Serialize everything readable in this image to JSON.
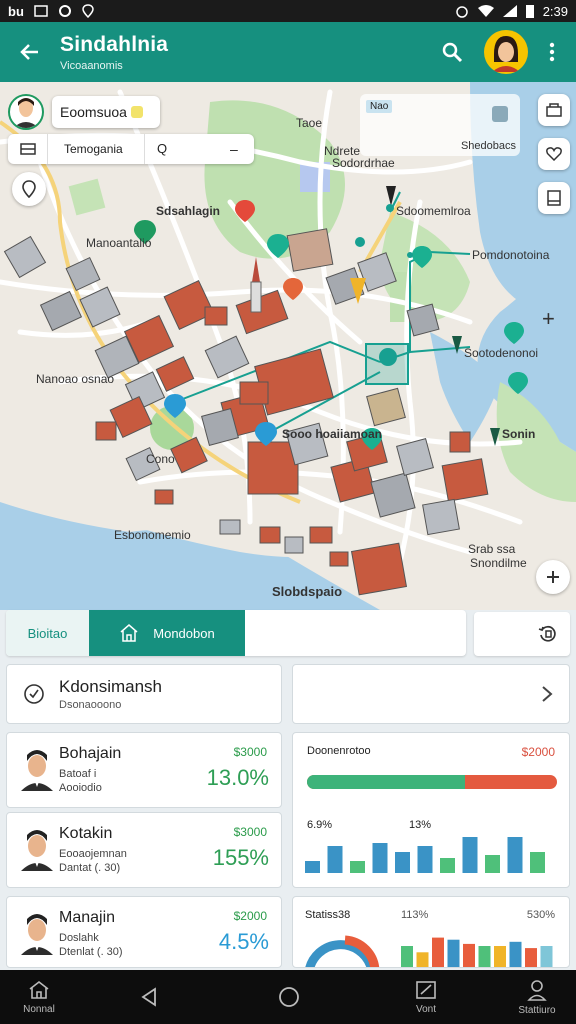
{
  "status_bar": {
    "left_text": "bu",
    "time": "2:39"
  },
  "app_bar": {
    "title": "Sindahlnia",
    "subtitle": "Vicoaanomis"
  },
  "map": {
    "search_chip": "Eoomsuoa",
    "filter_text": "Temogania",
    "filter_icon_label": "Q",
    "top_card_badge": "Nao",
    "top_card_right": "Shedobacs",
    "labels": {
      "tree": "Taoe",
      "north": "Ndrete",
      "north2": "Sodordrhae",
      "marker1": "Sdsahlagin",
      "marker2": "Sdoomemlroa",
      "west1": "Manoantalio",
      "east1": "Pomdonotoina",
      "center_right": "Sootodenonoi",
      "left_mid": "Nanoao osnao",
      "center": "Sooo hoaiiamoan",
      "center2": "Sonin",
      "south_left": "Esbonomemio",
      "south_right": "Srab ssa",
      "south_right2": "Snondilme",
      "bottom": "Slobdspaio",
      "park": "Cono"
    }
  },
  "tabs": [
    {
      "label": "Bioitao"
    },
    {
      "label": "Mondobon"
    }
  ],
  "place_card": {
    "name": "Kdonsimansh",
    "sub": "Dsonaooono"
  },
  "people": [
    {
      "name": "Bohajain",
      "line1": "Batoaf i",
      "line2": "Aooiodio",
      "amount": "$3000",
      "percent": "13.0%"
    },
    {
      "name": "Kotakin",
      "line1": "Eooaojemnan",
      "line2": "Dantat (. 30)",
      "amount": "$3000",
      "percent": "155%"
    },
    {
      "name": "Manajin",
      "line1": "Doslahk",
      "line2": "Dtenlat (. 30)",
      "amount": "$2000",
      "percent": "4.5%"
    }
  ],
  "stats": {
    "title": "Doonenrotoo",
    "value": "$2000",
    "progress": 0.63,
    "label_left": "6.9%",
    "label_mid": "13%",
    "bars": [
      0.2,
      0.45,
      0.2,
      0.5,
      0.35,
      0.45,
      0.25,
      0.6,
      0.3,
      0.6,
      0.35
    ],
    "bar_colors": [
      "#3a93c6",
      "#3a93c6",
      "#4fc07a",
      "#3a93c6",
      "#3a93c6",
      "#3a93c6",
      "#4fc07a",
      "#3a93c6",
      "#4fc07a",
      "#3a93c6",
      "#4fc07a"
    ]
  },
  "stats2": {
    "title": "Statiss38",
    "mid": "113%",
    "right": "530%",
    "bars": [
      0.5,
      0.35,
      0.7,
      0.65,
      0.55,
      0.5,
      0.5,
      0.6,
      0.45,
      0.5
    ],
    "bar_colors": [
      "#4fc07a",
      "#f0b429",
      "#e85d3c",
      "#3a93c6",
      "#e85d3c",
      "#4fc07a",
      "#f0b429",
      "#3a93c6",
      "#e85d3c",
      "#7fc6d8"
    ]
  },
  "bottom_nav": [
    {
      "label": "Nonnal"
    },
    {
      "label": "Vont"
    },
    {
      "label": "Stattiuro"
    }
  ],
  "colors": {
    "accent": "#16907f",
    "accent_dark": "#0f6f62"
  }
}
